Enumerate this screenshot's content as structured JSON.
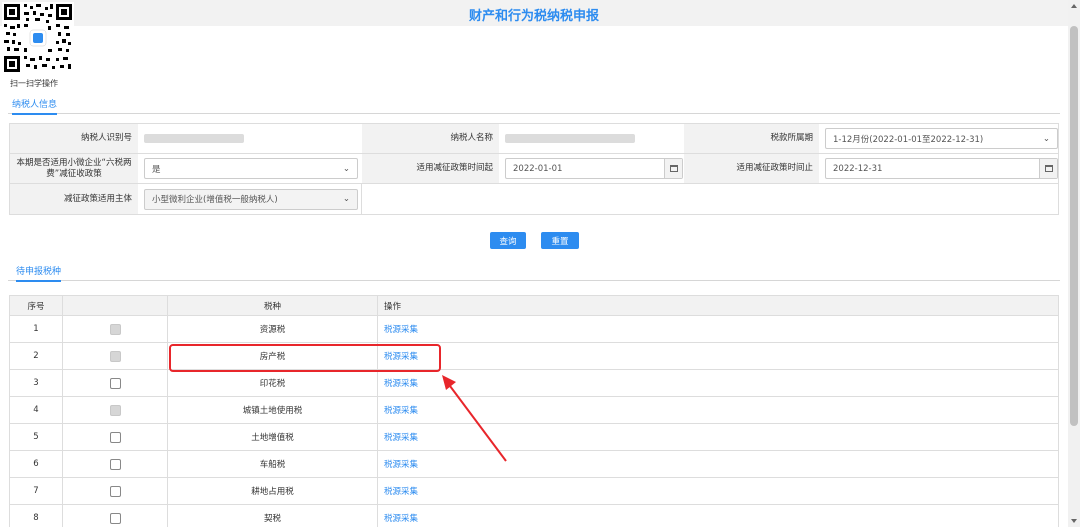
{
  "page": {
    "title": "财产和行为税纳税申报"
  },
  "qr": {
    "caption": "扫一扫学操作"
  },
  "tabs": {
    "taxpayer_info": "纳税人信息",
    "pending": "待申报税种"
  },
  "form": {
    "taxpayer_id_label": "纳税人识别号",
    "taxpayer_name_label": "纳税人名称",
    "tax_period_label": "税款所属期",
    "tax_period_value": "1-12月份(2022-01-01至2022-12-31)",
    "small_policy_label": "本期是否适用小微企业“六税两费”减征收政策",
    "small_policy_value": "是",
    "reduction_start_label": "适用减征政策时间起",
    "reduction_start_value": "2022-01-01",
    "reduction_end_label": "适用减征政策时间止",
    "reduction_end_value": "2022-12-31",
    "subject_label": "减征政策适用主体",
    "subject_value": "小型微利企业(增值税一般纳税人)"
  },
  "buttons": {
    "query": "查询",
    "reset": "重置"
  },
  "table": {
    "headers": [
      "序号",
      "",
      "税种",
      "操作"
    ],
    "rows": [
      {
        "no": "1",
        "tax": "资源税",
        "action": "税源采集",
        "checkbox_disabled": true
      },
      {
        "no": "2",
        "tax": "房产税",
        "action": "税源采集",
        "checkbox_disabled": true
      },
      {
        "no": "3",
        "tax": "印花税",
        "action": "税源采集",
        "checkbox_disabled": false
      },
      {
        "no": "4",
        "tax": "城镇土地使用税",
        "action": "税源采集",
        "checkbox_disabled": true
      },
      {
        "no": "5",
        "tax": "土地增值税",
        "action": "税源采集",
        "checkbox_disabled": false
      },
      {
        "no": "6",
        "tax": "车船税",
        "action": "税源采集",
        "checkbox_disabled": false
      },
      {
        "no": "7",
        "tax": "耕地占用税",
        "action": "税源采集",
        "checkbox_disabled": false
      },
      {
        "no": "8",
        "tax": "契税",
        "action": "税源采集",
        "checkbox_disabled": false
      }
    ]
  },
  "colors": {
    "accent": "#2d8cf0",
    "annotation": "#e8262b",
    "header_bg": "#f2f2f2"
  },
  "icons": {
    "calendar": "calendar-icon",
    "dropdown": "chevron-down-icon",
    "arrow": "red-arrow"
  }
}
